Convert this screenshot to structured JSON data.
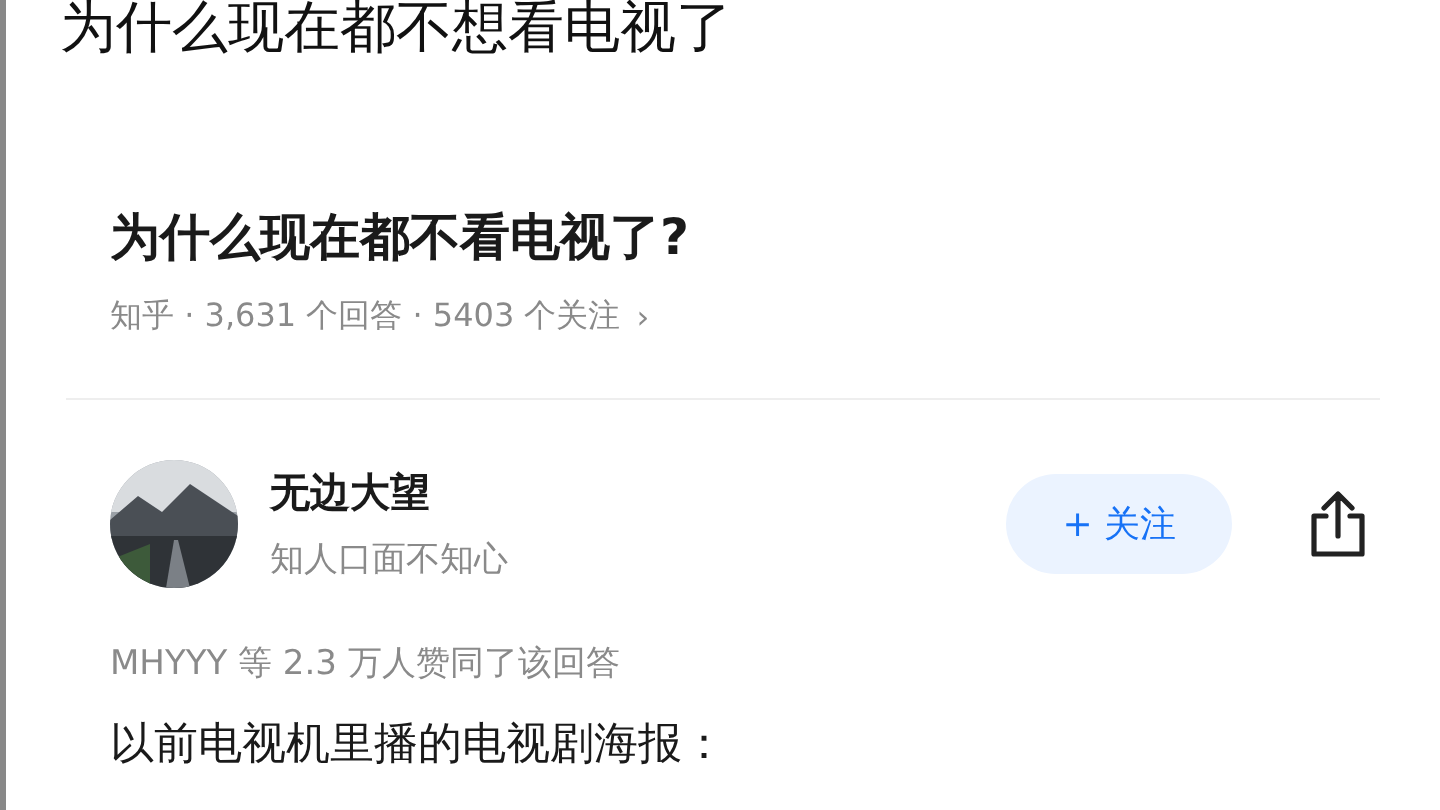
{
  "page_title": "为什么现在都不想看电视了",
  "question": {
    "title": "为什么现在都不看电视了?",
    "meta": "知乎 · 3,631 个回答 · 5403 个关注",
    "chevron": "›"
  },
  "answer": {
    "author": {
      "name": "无边大望",
      "bio": "知人口面不知心"
    },
    "follow_button": "+ 关注",
    "upvotes": "MHYYY 等 2.3 万人赞同了该回答",
    "content": "以前电视机里播的电视剧海报："
  }
}
